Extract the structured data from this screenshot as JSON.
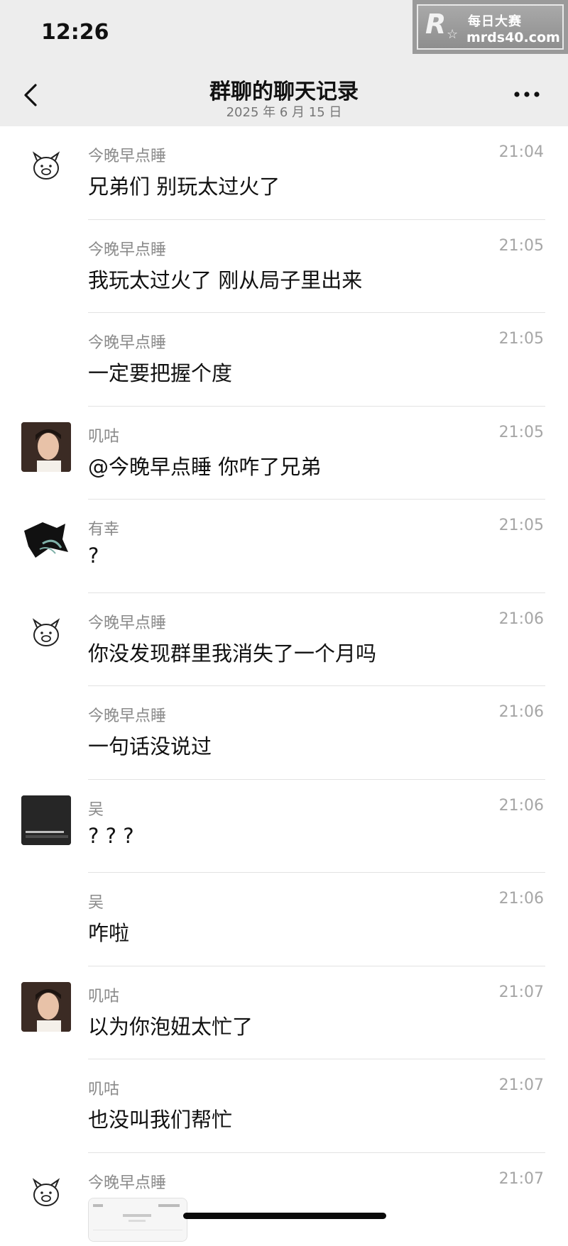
{
  "status_bar": {
    "time": "12:26"
  },
  "watermark": {
    "logo": "R",
    "line1": "每日大赛",
    "line2": "mrds40.com"
  },
  "nav": {
    "title": "群聊的聊天记录",
    "subtitle": "2025 年 6 月 15 日"
  },
  "messages": [
    {
      "sender": "今晚早点睡",
      "time": "21:04",
      "text": "兄弟们 别玩太过火了",
      "avatar": "pig-doodle-icon"
    },
    {
      "sender": "今晚早点睡",
      "time": "21:05",
      "text": "我玩太过火了 刚从局子里出来",
      "avatar": ""
    },
    {
      "sender": "今晚早点睡",
      "time": "21:05",
      "text": "一定要把握个度",
      "avatar": ""
    },
    {
      "sender": "叽咕",
      "time": "21:05",
      "text": "@今晚早点睡 你咋了兄弟",
      "avatar": "portrait-photo"
    },
    {
      "sender": "有幸",
      "time": "21:05",
      "text": "?",
      "avatar": "dark-anime-icon"
    },
    {
      "sender": "今晚早点睡",
      "time": "21:06",
      "text": "你没发现群里我消失了一个月吗",
      "avatar": "pig-doodle-icon"
    },
    {
      "sender": "今晚早点睡",
      "time": "21:06",
      "text": "一句话没说过",
      "avatar": ""
    },
    {
      "sender": "吴",
      "time": "21:06",
      "text": "? ? ?",
      "avatar": "dark-tile-icon"
    },
    {
      "sender": "吴",
      "time": "21:06",
      "text": "咋啦",
      "avatar": ""
    },
    {
      "sender": "叽咕",
      "time": "21:07",
      "text": "以为你泡妞太忙了",
      "avatar": "portrait-photo"
    },
    {
      "sender": "叽咕",
      "time": "21:07",
      "text": "也没叫我们帮忙",
      "avatar": ""
    },
    {
      "sender": "今晚早点睡",
      "time": "21:07",
      "text": "",
      "avatar": "pig-doodle-icon"
    }
  ]
}
